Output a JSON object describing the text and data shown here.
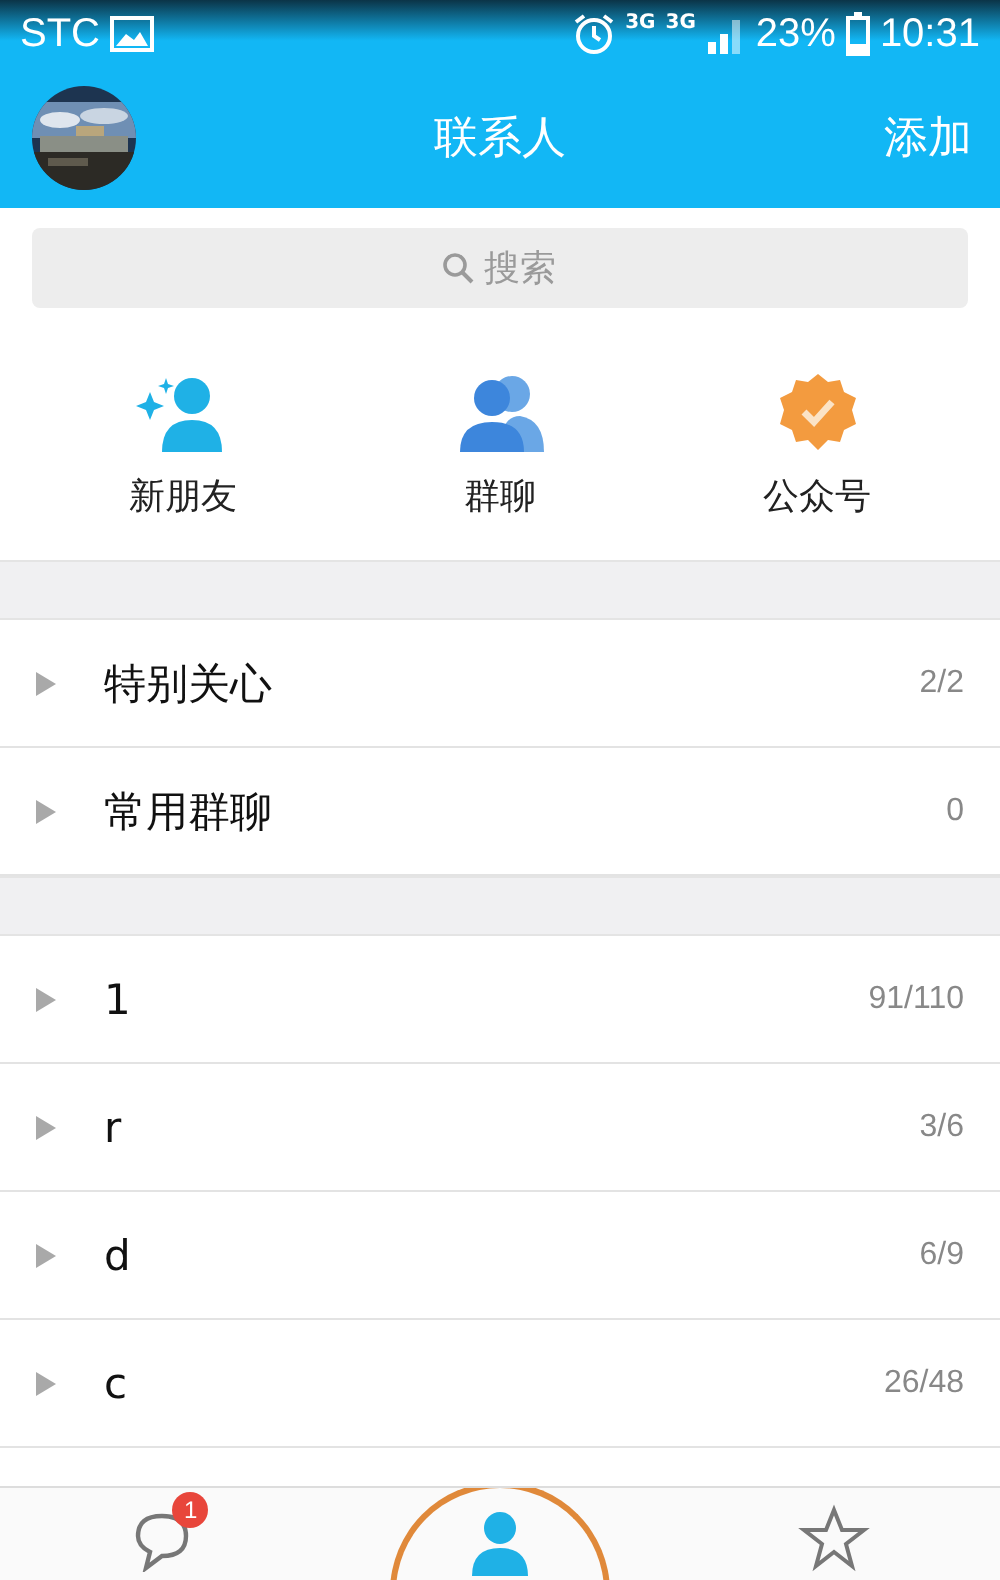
{
  "status_bar": {
    "carrier": "STC",
    "network_1": "3G",
    "network_2": "3G",
    "battery": "23%",
    "time": "10:31"
  },
  "header": {
    "title": "联系人",
    "action": "添加"
  },
  "search": {
    "placeholder": "搜索"
  },
  "shortcuts": [
    {
      "kind": "new-friend",
      "label": "新朋友"
    },
    {
      "kind": "group-chat",
      "label": "群聊"
    },
    {
      "kind": "official",
      "label": "公众号"
    }
  ],
  "sections": [
    {
      "groups": [
        {
          "name": "特别关心",
          "count": "2/2",
          "expanded": false
        },
        {
          "name": "常用群聊",
          "count": "0",
          "expanded": false
        }
      ]
    },
    {
      "groups": [
        {
          "name": "1",
          "count": "91/110",
          "expanded": false
        },
        {
          "name": "r",
          "count": "3/6",
          "expanded": false
        },
        {
          "name": "d",
          "count": "6/9",
          "expanded": false
        },
        {
          "name": "c",
          "count": "26/48",
          "expanded": false
        }
      ]
    }
  ],
  "tab_bar": [
    {
      "kind": "messages",
      "badge": "1",
      "selected": false
    },
    {
      "kind": "contacts",
      "selected": true
    },
    {
      "kind": "favorites",
      "selected": false
    }
  ]
}
